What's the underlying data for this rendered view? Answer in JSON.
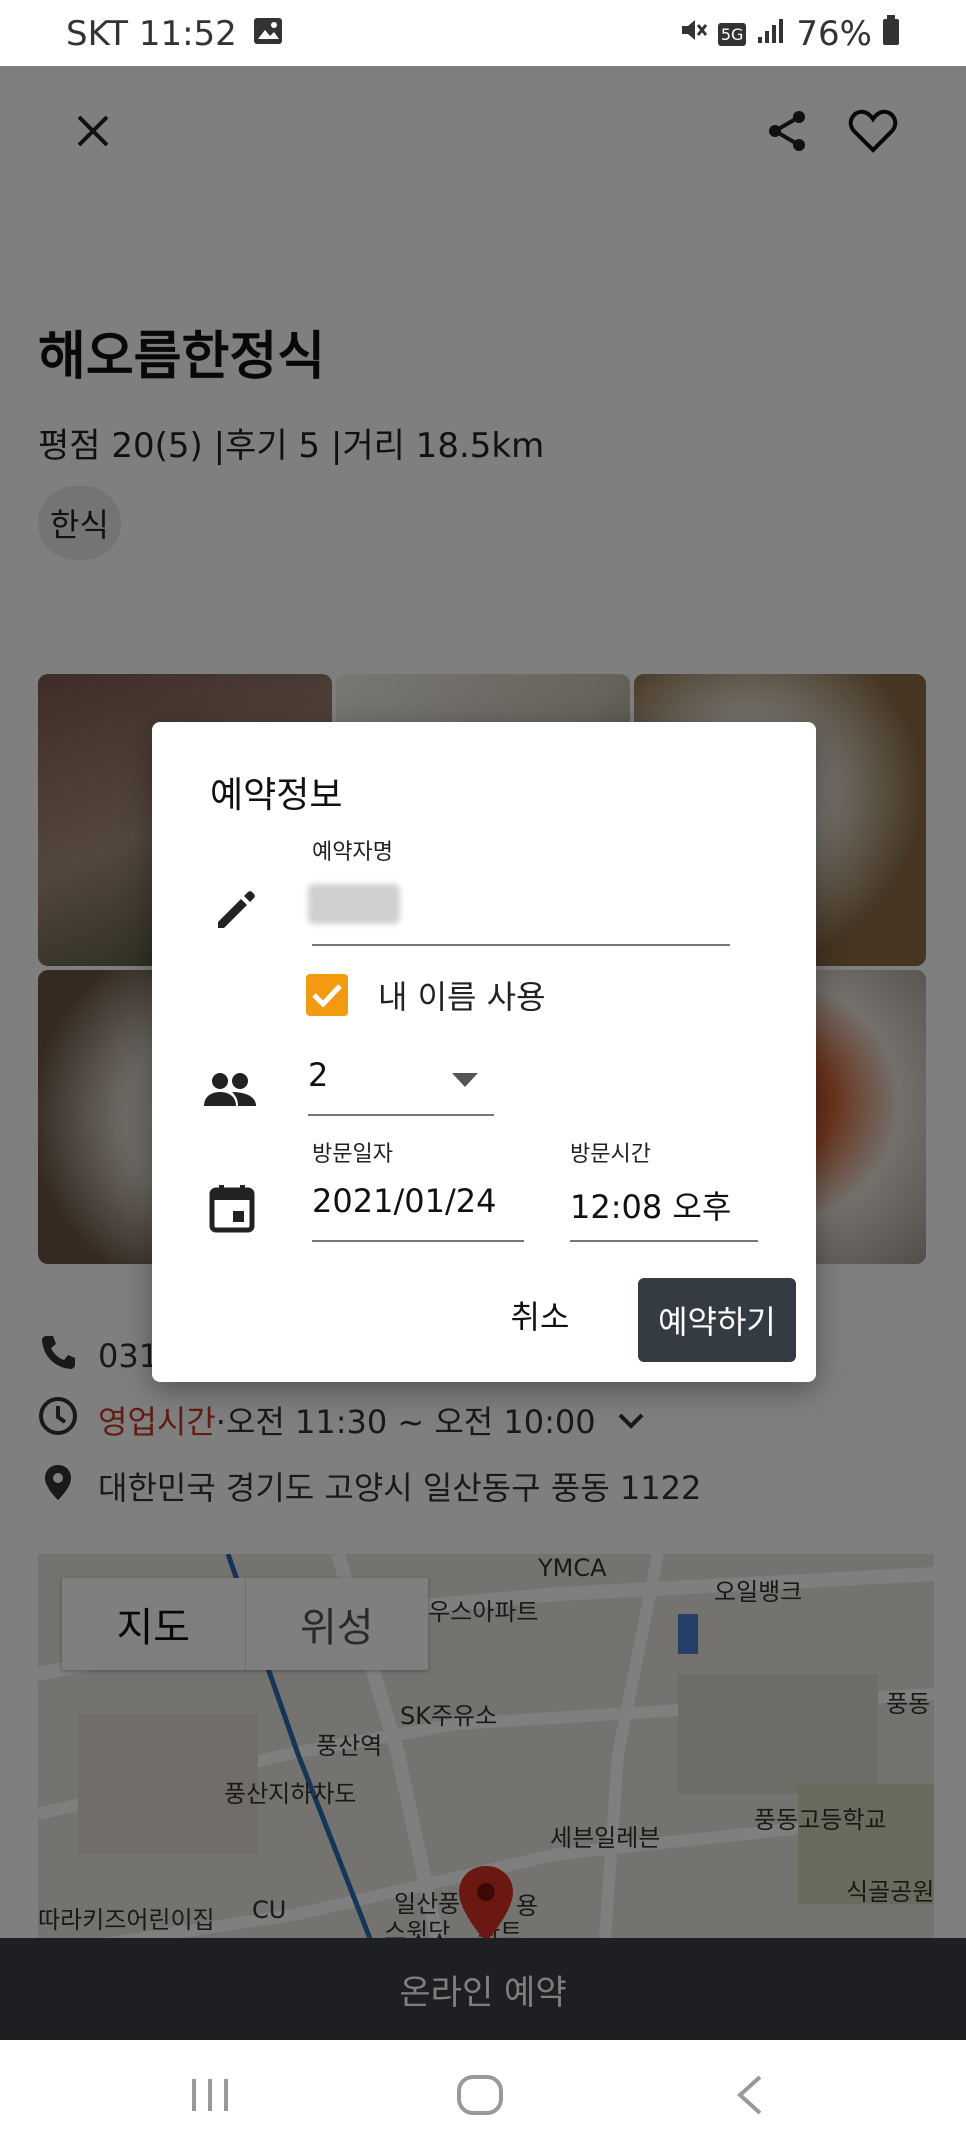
{
  "status_bar": {
    "carrier_time": "SKT 11:52",
    "battery": "76%",
    "network_badge": "5G"
  },
  "restaurant": {
    "name": "해오름한정식",
    "meta": "평점 20(5) |후기 5 |거리 18.5km",
    "category": "한식",
    "phone_partial": "031",
    "hours_label": "영업시간",
    "hours_value": "·오전 11:30 ~ 오전 10:00",
    "address": "대한민국 경기도 고양시 일산동구 풍동 1122"
  },
  "map": {
    "toggle_map": "지도",
    "toggle_satellite": "위성",
    "labels": [
      "하우스아파트",
      "오일뱅크",
      "풍동",
      "SK주유소",
      "풍산역",
      "풍산지하차도",
      "세븐일레븐",
      "풍동고등학교",
      "식골공원",
      "따라키즈어린이집",
      "CU",
      "일산풍",
      "용",
      "스윗닷",
      "파트",
      "YMCA"
    ]
  },
  "bottom_bar": {
    "label": "온라인 예약"
  },
  "dialog": {
    "title": "예약정보",
    "name_label": "예약자명",
    "use_my_name": "내 이름 사용",
    "party_size": "2",
    "date_label": "방문일자",
    "date_value": "2021/01/24",
    "time_label": "방문시간",
    "time_value": "12:08 오후",
    "cancel": "취소",
    "confirm": "예약하기"
  },
  "colors": {
    "accent_checkbox": "#f39a11",
    "primary_button": "#353b43",
    "hours_label": "#c0392b"
  }
}
